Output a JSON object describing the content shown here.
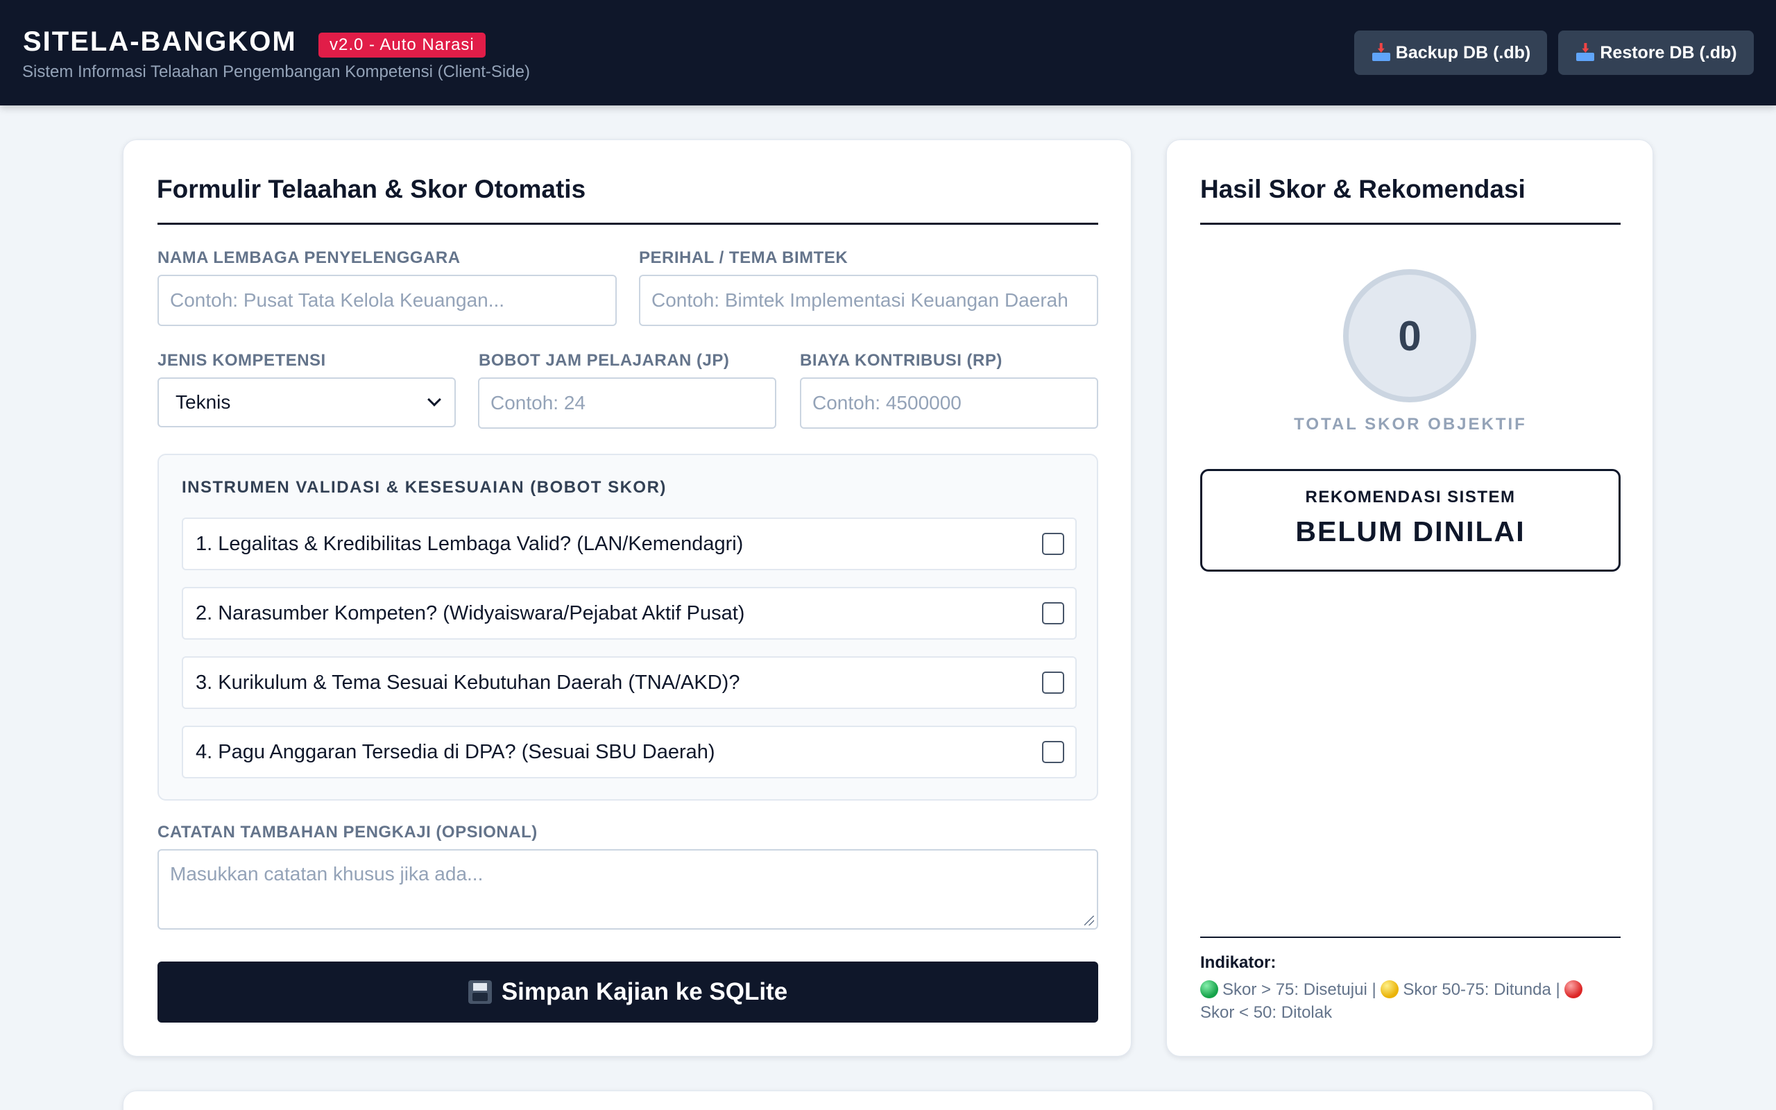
{
  "header": {
    "title": "SITELA-BANGKOM",
    "version_badge": "v2.0 - Auto Narasi",
    "subtitle": "Sistem Informasi Telaahan Pengembangan Kompetensi (Client-Side)",
    "backup_label": "Backup DB (.db)",
    "restore_label": "Restore DB (.db)",
    "backup_icon": "inbox-tray-icon",
    "restore_icon": "inbox-tray-icon"
  },
  "form": {
    "title": "Formulir Telaahan & Skor Otomatis",
    "lembaga": {
      "label": "NAMA LEMBAGA PENYELENGGARA",
      "placeholder": "Contoh: Pusat Tata Kelola Keuangan..."
    },
    "perihal": {
      "label": "PERIHAL / TEMA BIMTEK",
      "placeholder": "Contoh: Bimtek Implementasi Keuangan Daerah"
    },
    "jenis": {
      "label": "JENIS KOMPETENSI",
      "value": "Teknis"
    },
    "jp": {
      "label": "BOBOT JAM PELAJARAN (JP)",
      "placeholder": "Contoh: 24"
    },
    "biaya": {
      "label": "BIAYA KONTRIBUSI (RP)",
      "placeholder": "Contoh: 4500000"
    },
    "instrumen": {
      "title": "INSTRUMEN VALIDASI & KESESUAIAN (BOBOT SKOR)",
      "items": [
        {
          "label": "1. Legalitas & Kredibilitas Lembaga Valid? (LAN/Kemendagri)",
          "checked": false
        },
        {
          "label": "2. Narasumber Kompeten? (Widyaiswara/Pejabat Aktif Pusat)",
          "checked": false
        },
        {
          "label": "3. Kurikulum & Tema Sesuai Kebutuhan Daerah (TNA/AKD)?",
          "checked": false
        },
        {
          "label": "4. Pagu Anggaran Tersedia di DPA? (Sesuai SBU Daerah)",
          "checked": false
        }
      ]
    },
    "catatan": {
      "label": "CATATAN TAMBAHAN PENGKAJI (OPSIONAL)",
      "placeholder": "Masukkan catatan khusus jika ada..."
    },
    "save_label": "Simpan Kajian ke SQLite",
    "save_icon": "floppy-disk-icon"
  },
  "result": {
    "title": "Hasil Skor & Rekomendasi",
    "score": "0",
    "score_label": "TOTAL SKOR OBJEKTIF",
    "rec_label": "REKOMENDASI SISTEM",
    "rec_value": "BELUM DINILAI",
    "indikator_title": "Indikator:",
    "indikator": {
      "green": "Skor > 75: Disetujui |",
      "yellow": "Skor 50-75: Ditunda |",
      "red": "Skor < 50: Ditolak"
    }
  },
  "colors": {
    "header_bg": "#0f172a",
    "badge": "#e11d48",
    "primary": "#0f172a",
    "page_bg": "#f1f5f9"
  }
}
